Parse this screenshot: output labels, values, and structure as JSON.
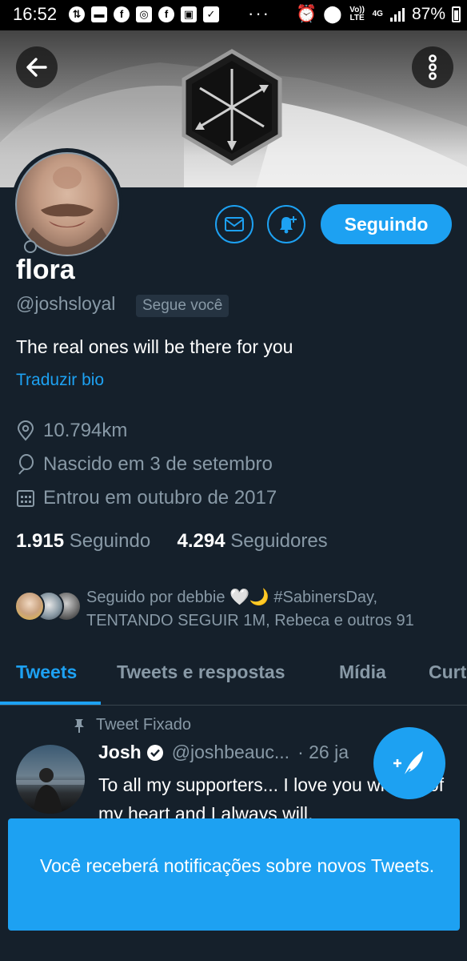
{
  "status_bar": {
    "time": "16:52",
    "notification_icons": [
      "usb-icon",
      "message-icon",
      "facebook-icon",
      "instagram-icon",
      "facebook-icon",
      "image-icon",
      "check-icon"
    ],
    "overflow": "···",
    "volte_label": "Vo)) LTE",
    "network_label": "4G",
    "battery": "87%"
  },
  "profile": {
    "name": "flora",
    "handle": "@joshsloyal",
    "follows_you": "Segue você",
    "bio": "The real ones will be there for you",
    "translate_bio": "Traduzir bio",
    "location": "10.794km",
    "birthday": "Nascido em 3 de setembro",
    "joined": "Entrou em outubro de 2017",
    "following_count": "1.915",
    "following_label": "Seguindo",
    "followers_count": "4.294",
    "followers_label": "Seguidores",
    "followed_by": "Seguido por debbie 🤍🌙 #SabinersDay, TENTANDO SEGUIR 1M, Rebeca e outros 91"
  },
  "actions": {
    "following_button": "Seguindo"
  },
  "tabs": [
    {
      "label": "Tweets",
      "active": true
    },
    {
      "label": "Tweets e respostas",
      "active": false
    },
    {
      "label": "Mídia",
      "active": false
    },
    {
      "label": "Curt",
      "active": false
    }
  ],
  "pinned_tweet": {
    "pinned_label": "Tweet Fixado",
    "author_name": "Josh",
    "author_handle": "@joshbeauc...",
    "date": "· 26 ja",
    "text": "To all my supporters... I love you with all of my heart and I always will."
  },
  "toast": {
    "message": "Você receberá notificações sobre novos Tweets."
  },
  "colors": {
    "background": "#15202b",
    "accent": "#1da1f2",
    "secondary_text": "#8899a6"
  }
}
